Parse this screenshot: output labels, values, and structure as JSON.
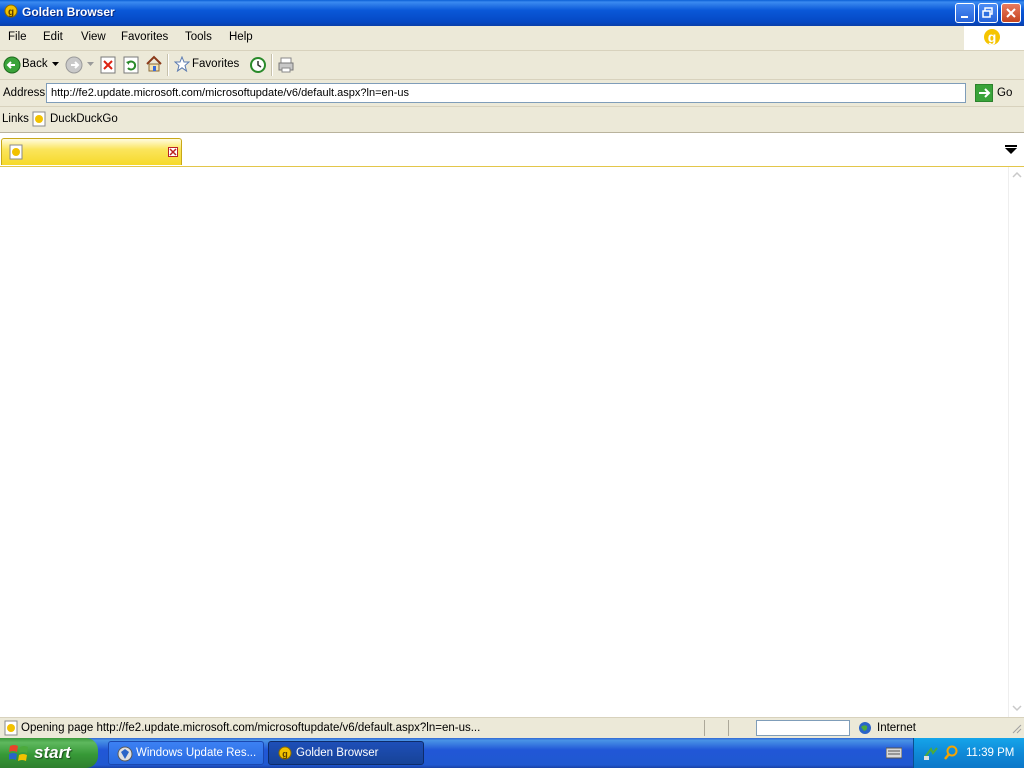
{
  "window": {
    "title": "Golden Browser"
  },
  "menu": {
    "items": [
      "File",
      "Edit",
      "View",
      "Favorites",
      "Tools",
      "Help"
    ]
  },
  "toolbar": {
    "back_label": "Back",
    "favorites_label": "Favorites"
  },
  "address": {
    "label": "Address",
    "value": "http://fe2.update.microsoft.com/microsoftupdate/v6/default.aspx?ln=en-us",
    "go_label": "Go"
  },
  "links": {
    "label": "Links",
    "items": [
      "DuckDuckGo"
    ]
  },
  "tabs": [
    {
      "label": ""
    }
  ],
  "status": {
    "text": "Opening page http://fe2.update.microsoft.com/microsoftupdate/v6/default.aspx?ln=en-us...",
    "zone": "Internet"
  },
  "taskbar": {
    "start_label": "start",
    "tasks": [
      {
        "label": "Windows Update Res..."
      },
      {
        "label": "Golden Browser"
      }
    ],
    "clock": "11:39 PM"
  },
  "colors": {
    "titlebar_blue": "#0a58d8",
    "tab_yellow": "#f6d92a",
    "start_green": "#379937"
  }
}
